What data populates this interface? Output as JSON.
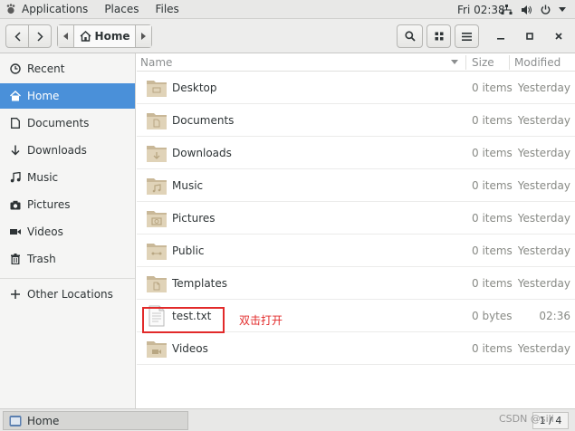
{
  "topbar": {
    "applications": "Applications",
    "places": "Places",
    "files": "Files",
    "clock": "Fri 02:38",
    "network_icon": "network-icon",
    "volume_icon": "volume-icon",
    "power_icon": "power-icon"
  },
  "headerbar": {
    "back_icon": "back-icon",
    "forward_icon": "forward-icon",
    "path_label": "Home",
    "search_icon": "search-icon",
    "grid_icon": "grid-view-icon",
    "menu_icon": "menu-icon"
  },
  "sidebar": {
    "items": [
      {
        "label": "Recent",
        "icon": "clock-icon"
      },
      {
        "label": "Home",
        "icon": "home-icon",
        "active": true
      },
      {
        "label": "Documents",
        "icon": "document-icon"
      },
      {
        "label": "Downloads",
        "icon": "download-icon"
      },
      {
        "label": "Music",
        "icon": "music-icon"
      },
      {
        "label": "Pictures",
        "icon": "camera-icon"
      },
      {
        "label": "Videos",
        "icon": "video-icon"
      },
      {
        "label": "Trash",
        "icon": "trash-icon"
      }
    ],
    "other_locations": "Other Locations"
  },
  "columns": {
    "name": "Name",
    "size": "Size",
    "modified": "Modified"
  },
  "files": [
    {
      "name": "Desktop",
      "size": "0 items",
      "modified": "Yesterday"
    },
    {
      "name": "Documents",
      "size": "0 items",
      "modified": "Yesterday"
    },
    {
      "name": "Downloads",
      "size": "0 items",
      "modified": "Yesterday"
    },
    {
      "name": "Music",
      "size": "0 items",
      "modified": "Yesterday"
    },
    {
      "name": "Pictures",
      "size": "0 items",
      "modified": "Yesterday"
    },
    {
      "name": "Public",
      "size": "0 items",
      "modified": "Yesterday"
    },
    {
      "name": "Templates",
      "size": "0 items",
      "modified": "Yesterday"
    },
    {
      "name": "test.txt",
      "size": "0 bytes",
      "modified": "02:36"
    },
    {
      "name": "Videos",
      "size": "0 items",
      "modified": "Yesterday"
    }
  ],
  "annotation": "双击打开",
  "taskbar": {
    "window_label": "Home",
    "pager": "1 / 4",
    "watermark": "CSDN @sili"
  },
  "colors": {
    "accent": "#4a90d9",
    "folder": "#c9b898",
    "annotation": "#e22a2a"
  }
}
